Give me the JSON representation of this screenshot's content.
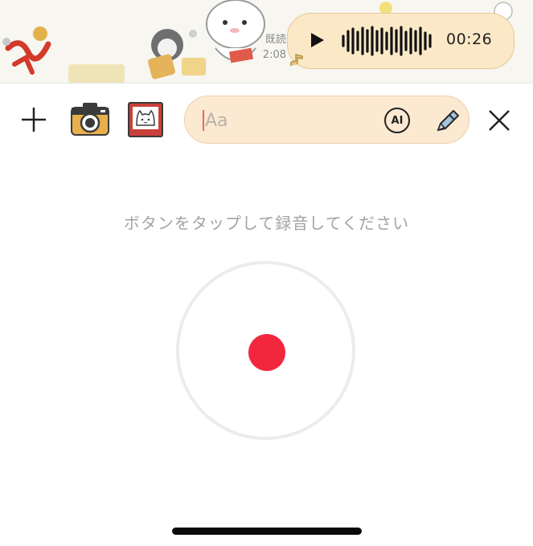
{
  "chat": {
    "read_label": "既読",
    "time": "2:08",
    "voice_message": {
      "duration": "00:26",
      "play_icon": "play-icon"
    }
  },
  "toolbar": {
    "add_icon": "plus-icon",
    "camera_icon": "camera-icon",
    "photo_icon": "photo-icon",
    "message_input": {
      "placeholder": "Aa",
      "value": ""
    },
    "ai_label": "AI",
    "pen_icon": "pen-icon",
    "close_icon": "close-icon"
  },
  "recorder": {
    "prompt": "ボタンをタップして録音してください"
  },
  "colors": {
    "bubble": "#fbe8c6",
    "input_bg": "#fbe9d2",
    "record_red": "#f2273e",
    "ring": "#ececec"
  }
}
